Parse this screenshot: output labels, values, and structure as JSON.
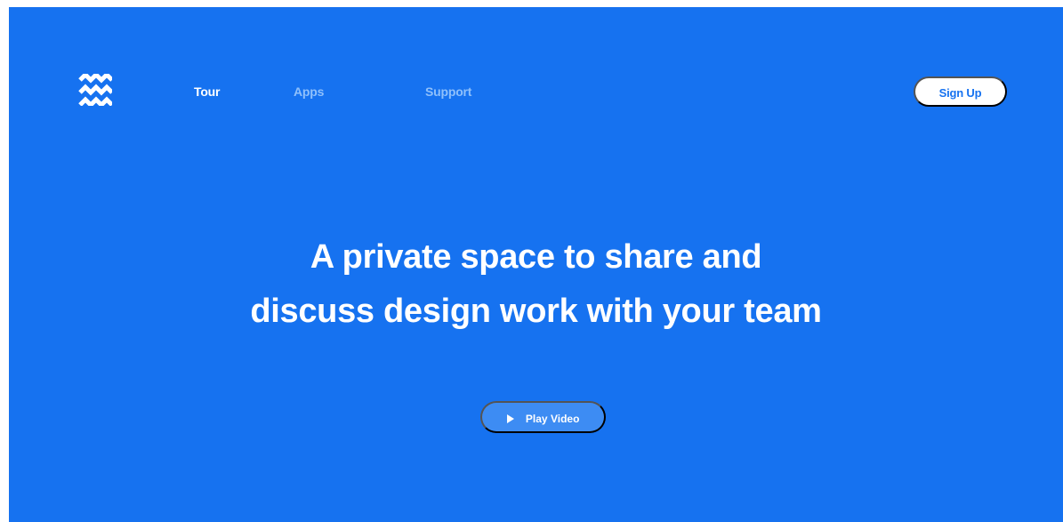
{
  "colors": {
    "background": "#1672f0",
    "active_nav": "#ffffff",
    "inactive_nav": "#8fc0fb",
    "button_background": "#ffffff",
    "button_text": "#1672f0",
    "play_button_background": "#3d8cf3"
  },
  "header": {
    "logo_icon": "wave-logo-icon",
    "nav": [
      {
        "label": "Tour",
        "active": true
      },
      {
        "label": "Apps",
        "active": false
      },
      {
        "label": "Support",
        "active": false
      }
    ],
    "signup_label": "Sign Up"
  },
  "hero": {
    "headline_lines": [
      "A private space to share and",
      "discuss design work with your team"
    ],
    "play_button": {
      "icon": "play-icon",
      "label": "Play Video"
    }
  }
}
